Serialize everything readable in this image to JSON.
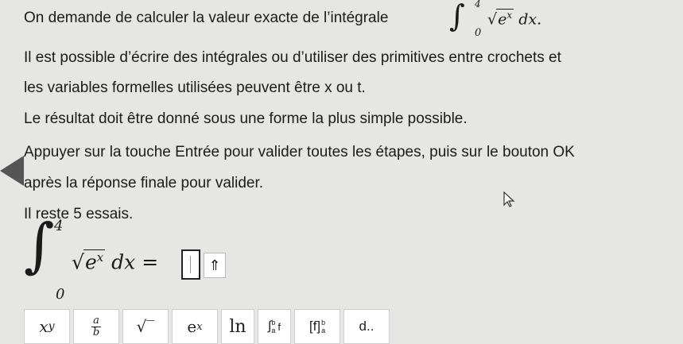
{
  "instructions": {
    "line1_prefix": "On demande de calculer la valeur exacte de l’intégrale",
    "integral": {
      "upper": "4",
      "lower": "0",
      "radicand": "e",
      "exp": "x",
      "dx": "dx."
    },
    "line2": "Il est possible d’écrire des intégrales ou d’utiliser des primitives entre crochets et",
    "line3": "les variables formelles utilisées peuvent être x ou t.",
    "line4": "Le résultat doit être donné sous une forme la plus simple possible.",
    "line5": "Appuyer sur la touche Entrée pour valider toutes les étapes, puis sur le bouton OK",
    "line6": "après la réponse finale pour valider.",
    "line7": "Il reste 5 essais."
  },
  "answer": {
    "upper": "4",
    "lower": "0",
    "radicand": "e",
    "exp": "x",
    "dx": "dx",
    "equals": "=",
    "input_value": "",
    "submit_symbol": "⇑"
  },
  "toolbar": {
    "power": {
      "base": "x",
      "exp": "y"
    },
    "fraction": {
      "num": "a",
      "den": "b"
    },
    "sqrt": "√‾",
    "exp": {
      "base": "e",
      "exp": "x"
    },
    "ln": "ln",
    "integral": {
      "sign": "∫",
      "upper": "b",
      "lower": "a",
      "f": "f"
    },
    "bracket": {
      "text": "[f]",
      "upper": "b",
      "lower": "a"
    },
    "derivative": "d.."
  }
}
